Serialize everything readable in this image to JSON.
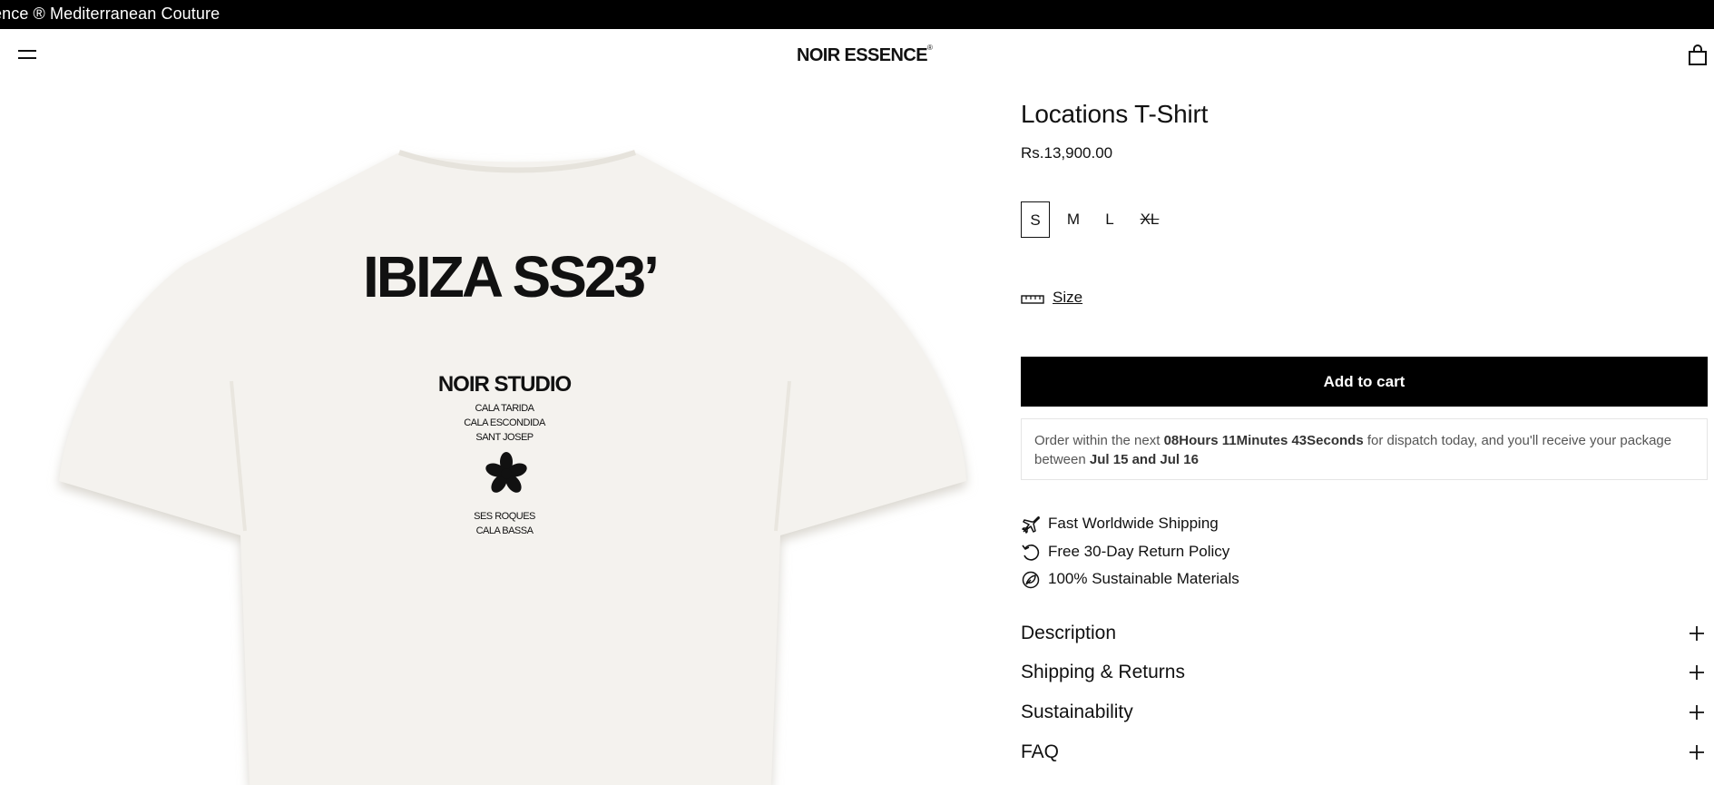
{
  "announcement": {
    "text": "ence ® Mediterranean Couture"
  },
  "header": {
    "logo": "NOIR ESSENCE",
    "logo_mark": "®",
    "menu_icon": "hamburger-menu-icon",
    "cart_icon": "shopping-bag-icon"
  },
  "gallery": {
    "image_alt": "Locations T-Shirt back print",
    "print": {
      "headline": "IBIZA SS23’",
      "studio": "NOIR STUDIO",
      "locations_top": [
        "CALA TARIDA",
        "CALA ESCONDIDA",
        "SANT JOSEP"
      ],
      "locations_bottom": [
        "SES ROQUES",
        "CALA BASSA"
      ]
    }
  },
  "product": {
    "title": "Locations T-Shirt",
    "price": "Rs.13,900.00",
    "sizes": [
      {
        "label": "S",
        "selected": true,
        "available": true
      },
      {
        "label": "M",
        "selected": false,
        "available": true
      },
      {
        "label": "L",
        "selected": false,
        "available": true
      },
      {
        "label": "XL",
        "selected": false,
        "available": false
      }
    ],
    "size_guide_label": "Size",
    "add_to_cart_label": "Add to cart"
  },
  "dispatch": {
    "prefix": "Order within the next ",
    "countdown": "08Hours 11Minutes 43Seconds",
    "middle": " for dispatch today, and you'll receive your package between ",
    "dates": "Jul 15 and Jul 16"
  },
  "features": [
    {
      "icon": "plane-icon",
      "label": "Fast Worldwide Shipping"
    },
    {
      "icon": "return-arrow-icon",
      "label": "Free 30-Day Return Policy"
    },
    {
      "icon": "leaf-icon",
      "label": "100% Sustainable Materials"
    }
  ],
  "accordions": [
    {
      "label": "Description"
    },
    {
      "label": "Shipping & Returns"
    },
    {
      "label": "Sustainability"
    },
    {
      "label": "FAQ"
    }
  ],
  "colors": {
    "announcement_bg": "#000000",
    "button_bg": "#000000",
    "button_text": "#ffffff",
    "shirt": "#f4f2ee",
    "text": "#111111"
  }
}
